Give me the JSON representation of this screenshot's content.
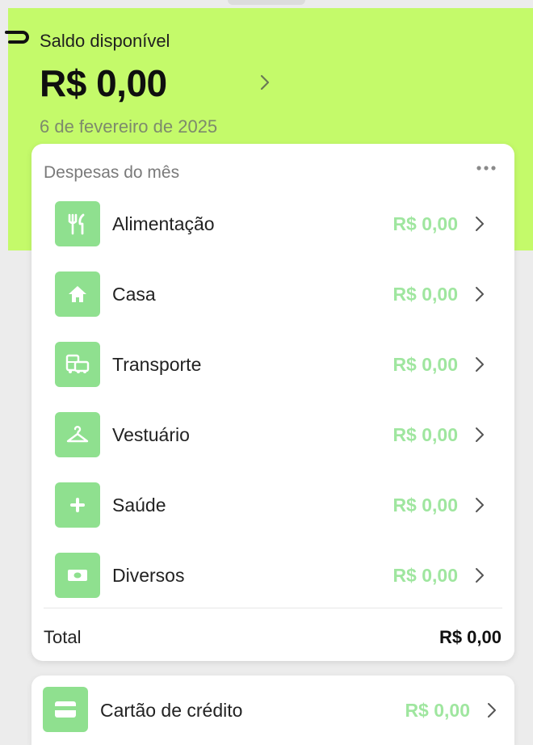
{
  "balance": {
    "label": "Saldo disponível",
    "value": "R$ 0,00",
    "date": "6 de fevereiro de 2025"
  },
  "expenses": {
    "title": "Despesas do mês",
    "items": [
      {
        "label": "Alimentação",
        "value": "R$ 0,00",
        "icon": "fork-knife-icon"
      },
      {
        "label": "Casa",
        "value": "R$ 0,00",
        "icon": "house-icon"
      },
      {
        "label": "Transporte",
        "value": "R$ 0,00",
        "icon": "bus-car-icon"
      },
      {
        "label": "Vestuário",
        "value": "R$ 0,00",
        "icon": "hanger-icon"
      },
      {
        "label": "Saúde",
        "value": "R$ 0,00",
        "icon": "plus-icon"
      },
      {
        "label": "Diversos",
        "value": "R$ 0,00",
        "icon": "banknote-icon"
      }
    ],
    "total_label": "Total",
    "total_value": "R$ 0,00"
  },
  "credit_card": {
    "label": "Cartão de crédito",
    "value": "R$ 0,00",
    "icon": "credit-card-icon"
  },
  "colors": {
    "hero_background": "#c4fa6a",
    "icon_tile": "#8fe08f",
    "value_text": "#9fe69f"
  }
}
